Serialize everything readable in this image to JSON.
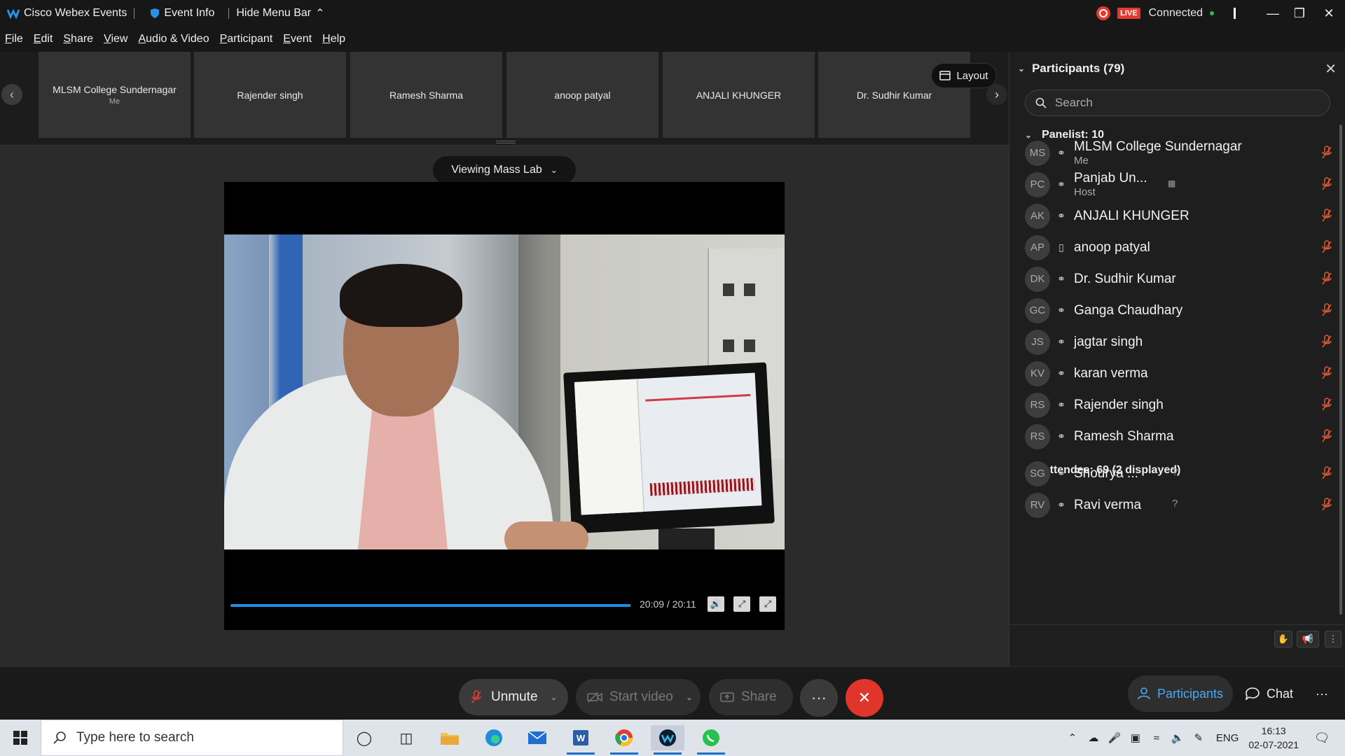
{
  "titlebar": {
    "app_name": "Cisco Webex Events",
    "event_info": "Event Info",
    "hide_menu": "Hide Menu Bar",
    "live": "LIVE",
    "status": "Connected"
  },
  "menu": [
    "File",
    "Edit",
    "Share",
    "View",
    "Audio & Video",
    "Participant",
    "Event",
    "Help"
  ],
  "filmstrip": {
    "tiles": [
      {
        "name": "MLSM College Sundernagar",
        "sub": "Me"
      },
      {
        "name": "Rajender singh",
        "sub": ""
      },
      {
        "name": "Ramesh Sharma",
        "sub": ""
      },
      {
        "name": "anoop patyal",
        "sub": ""
      },
      {
        "name": "ANJALI KHUNGER",
        "sub": ""
      },
      {
        "name": "Dr. Sudhir Kumar",
        "sub": ""
      }
    ],
    "layout_label": "Layout"
  },
  "stage": {
    "viewing_label": "Viewing Mass Lab",
    "time": "20:09 / 20:11",
    "progress": 0.998
  },
  "controls": {
    "unmute": "Unmute",
    "start_video": "Start video",
    "share": "Share",
    "more": "···",
    "participants_tab": "Participants",
    "chat_tab": "Chat"
  },
  "panel": {
    "title": "Participants (79)",
    "search_placeholder": "Search",
    "panelist_header": "Panelist: 10",
    "attendee_header": "Attendee: 69 (2 displayed)",
    "panelists": [
      {
        "initials": "MS",
        "name": "MLSM College Sundernagar",
        "role": "Me"
      },
      {
        "initials": "PC",
        "name": "Panjab Un...",
        "role": "Host"
      },
      {
        "initials": "AK",
        "name": "ANJALI KHUNGER",
        "role": ""
      },
      {
        "initials": "AP",
        "name": "anoop patyal",
        "role": ""
      },
      {
        "initials": "DK",
        "name": "Dr. Sudhir Kumar",
        "role": ""
      },
      {
        "initials": "GC",
        "name": "Ganga Chaudhary",
        "role": ""
      },
      {
        "initials": "JS",
        "name": "jagtar singh",
        "role": ""
      },
      {
        "initials": "KV",
        "name": "karan verma",
        "role": ""
      },
      {
        "initials": "RS",
        "name": "Rajender singh",
        "role": ""
      },
      {
        "initials": "RS",
        "name": "Ramesh Sharma",
        "role": ""
      }
    ],
    "attendees": [
      {
        "initials": "SG",
        "name": "Shourya ...",
        "extra": "?"
      },
      {
        "initials": "RV",
        "name": "Ravi verma",
        "extra": "?"
      }
    ]
  },
  "taskbar": {
    "search_placeholder": "Type here to search",
    "lang": "ENG",
    "time": "16:13",
    "date": "02-07-2021"
  },
  "colors": {
    "accent": "#1a8fe3",
    "end_call": "#e0352b",
    "mute_red": "#e23a2e"
  }
}
